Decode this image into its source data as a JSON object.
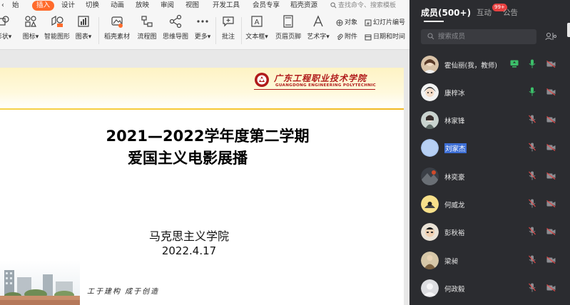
{
  "menubar": {
    "back_label": "‹",
    "items": [
      "始",
      "插入",
      "设计",
      "切换",
      "动画",
      "放映",
      "审阅",
      "视图",
      "开发工具",
      "会员专享",
      "稻壳资源"
    ],
    "active_index": 1,
    "search_placeholder": "查找命令、搜索模板",
    "accent": "#ff6b2c"
  },
  "ribbon": {
    "tools": [
      "形状",
      "图标",
      "智能图形",
      "图表",
      "稻壳素材",
      "流程图",
      "思维导图",
      "更多",
      "批注",
      "文本框",
      "页眉页脚",
      "艺术字"
    ],
    "small_tools": [
      "对象",
      "幻灯片编号",
      "附件",
      "日期和时间"
    ]
  },
  "slide": {
    "university_cn": "广东工程职业技术学院",
    "university_en": "GUANGDONG ENGINEERING POLYTECHNIC",
    "title_line1": "2021—2022学年度第二学期",
    "title_line2": "爱国主义电影展播",
    "school": "马克思主义学院",
    "date": "2022.4.17",
    "motto": "工于建构 成于创造",
    "brand_color": "#b01a1a"
  },
  "panel": {
    "tab_members": "成员(500+)",
    "tab_interact": "互动",
    "tab_interact_badge": "99+",
    "tab_notice": "公告",
    "search_placeholder": "搜索成员",
    "members": [
      {
        "name": "霍仙丽(我，教师)",
        "screen_share": true,
        "mic": "on",
        "camera": "off",
        "selected": false
      },
      {
        "name": "康梓冰",
        "screen_share": false,
        "mic": "on",
        "camera": "off",
        "selected": false
      },
      {
        "name": "林家锋",
        "screen_share": false,
        "mic": "off",
        "camera": "off",
        "selected": false
      },
      {
        "name": "刘家杰",
        "screen_share": false,
        "mic": "off",
        "camera": "off",
        "selected": true
      },
      {
        "name": "林奕豪",
        "screen_share": false,
        "mic": "off",
        "camera": "off",
        "selected": false
      },
      {
        "name": "何威龙",
        "screen_share": false,
        "mic": "off",
        "camera": "off",
        "selected": false
      },
      {
        "name": "彭秋裕",
        "screen_share": false,
        "mic": "off",
        "camera": "off",
        "selected": false
      },
      {
        "name": "梁昶",
        "screen_share": false,
        "mic": "off",
        "camera": "off",
        "selected": false
      },
      {
        "name": "何政毅",
        "screen_share": false,
        "mic": "off",
        "camera": "off",
        "selected": false
      }
    ],
    "colors": {
      "background": "#2b2c30",
      "mic_on": "#3cc06a",
      "selection": "#3d6fd6"
    }
  }
}
